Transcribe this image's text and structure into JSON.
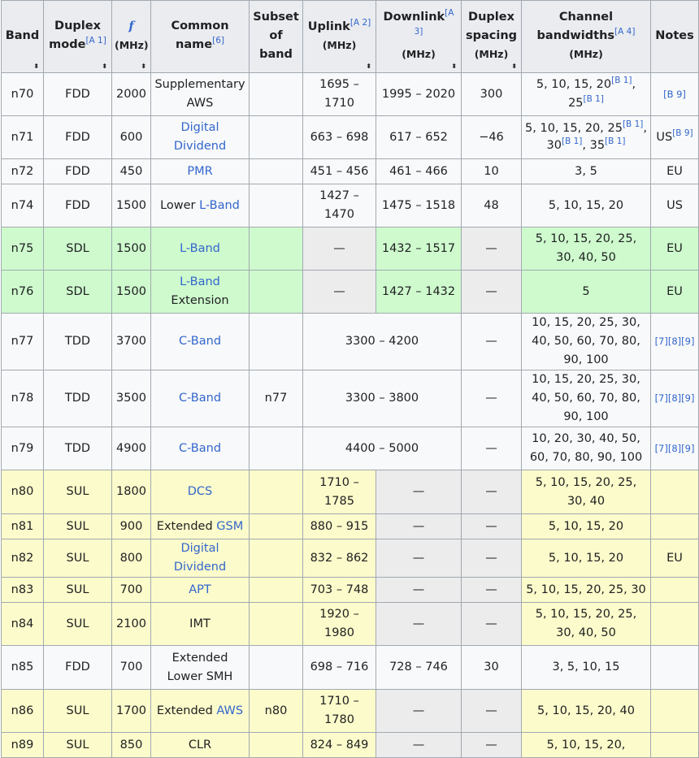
{
  "headers": {
    "band": "Band",
    "duplex_mode": "Duplex mode",
    "duplex_mode_ref": "[A 1]",
    "freq_symbol": "f",
    "freq_unit": "(MHz)",
    "common_name": "Common name",
    "common_name_ref": "[6]",
    "subset": "Subset of band",
    "uplink": "Uplink",
    "uplink_ref": "[A 2]",
    "uplink_unit": "(MHz)",
    "downlink": "Downlink",
    "downlink_ref": "[A 3]",
    "downlink_unit": "(MHz)",
    "duplex_spacing": "Duplex spacing",
    "duplex_spacing_unit": "(MHz)",
    "channel_bw": "Channel bandwidths",
    "channel_bw_ref": "[A 4]",
    "channel_bw_unit": "(MHz)",
    "notes": "Notes",
    "sort_glyph": "⬍"
  },
  "rows": {
    "n70": {
      "band": "n70",
      "mode": "FDD",
      "f": "2000",
      "name": "Supplementary AWS",
      "uplink": "1695 – 1710",
      "downlink": "1995 – 2020",
      "spacing": "300",
      "bw": "5, 10, 15, 20",
      "bw_ref": "[B 1]",
      "bw2": "25",
      "bw2_ref": "[B 1]",
      "notes_ref": "[B 9]"
    },
    "n71": {
      "band": "n71",
      "mode": "FDD",
      "f": "600",
      "name": "Digital Dividend",
      "uplink": "663 – 698",
      "downlink": "617 – 652",
      "spacing": "−46",
      "bw": "5, 10, 15, 20, 25",
      "bw_ref": "[B 1]",
      "bw2": "30",
      "bw2_ref": "[B 1]",
      "bw3": "35",
      "bw3_ref": "[B 1]",
      "notes": "US",
      "notes_ref": "[B 9]"
    },
    "n72": {
      "band": "n72",
      "mode": "FDD",
      "f": "450",
      "name": "PMR",
      "uplink": "451 – 456",
      "downlink": "461 – 466",
      "spacing": "10",
      "bw": "3, 5",
      "notes": "EU"
    },
    "n74": {
      "band": "n74",
      "mode": "FDD",
      "f": "1500",
      "name_prefix": "Lower",
      "name": "L-Band",
      "uplink": "1427 – 1470",
      "downlink": "1475 – 1518",
      "spacing": "48",
      "bw": "5, 10, 15, 20",
      "notes": "US"
    },
    "n75": {
      "band": "n75",
      "mode": "SDL",
      "f": "1500",
      "name": "L-Band",
      "uplink": "—",
      "downlink": "1432 – 1517",
      "spacing": "—",
      "bw": "5, 10, 15, 20, 25, 30, 40, 50",
      "notes": "EU"
    },
    "n76": {
      "band": "n76",
      "mode": "SDL",
      "f": "1500",
      "name": "L-Band",
      "name_suffix": "Extension",
      "uplink": "—",
      "downlink": "1427 – 1432",
      "spacing": "—",
      "bw": "5",
      "notes": "EU"
    },
    "n77": {
      "band": "n77",
      "mode": "TDD",
      "f": "3700",
      "name": "C-Band",
      "range": "3300 – 4200",
      "spacing": "—",
      "bw": "10, 15, 20, 25, 30, 40, 50, 60, 70, 80, 90, 100",
      "notes_ref": "[7][8][9]"
    },
    "n78": {
      "band": "n78",
      "mode": "TDD",
      "f": "3500",
      "name": "C-Band",
      "subset": "n77",
      "range": "3300 – 3800",
      "spacing": "—",
      "bw": "10, 15, 20, 25, 30, 40, 50, 60, 70, 80, 90, 100",
      "notes_ref": "[7][8][9]"
    },
    "n79": {
      "band": "n79",
      "mode": "TDD",
      "f": "4900",
      "name": "C-Band",
      "range": "4400 – 5000",
      "spacing": "—",
      "bw": "10, 20, 30, 40, 50, 60, 70, 80, 90, 100",
      "notes_ref": "[7][8][9]"
    },
    "n80": {
      "band": "n80",
      "mode": "SUL",
      "f": "1800",
      "name": "DCS",
      "uplink": "1710 – 1785",
      "downlink": "—",
      "spacing": "—",
      "bw": "5, 10, 15, 20, 25, 30, 40"
    },
    "n81": {
      "band": "n81",
      "mode": "SUL",
      "f": "900",
      "name_prefix": "Extended",
      "name": "GSM",
      "uplink": "880 – 915",
      "downlink": "—",
      "spacing": "—",
      "bw": "5, 10, 15, 20"
    },
    "n82": {
      "band": "n82",
      "mode": "SUL",
      "f": "800",
      "name": "Digital Dividend",
      "uplink": "832 – 862",
      "downlink": "—",
      "spacing": "—",
      "bw": "5, 10, 15, 20",
      "notes": "EU"
    },
    "n83": {
      "band": "n83",
      "mode": "SUL",
      "f": "700",
      "name": "APT",
      "uplink": "703 – 748",
      "downlink": "—",
      "spacing": "—",
      "bw": "5, 10, 15, 20, 25, 30"
    },
    "n84": {
      "band": "n84",
      "mode": "SUL",
      "f": "2100",
      "name": "IMT",
      "uplink": "1920 – 1980",
      "downlink": "—",
      "spacing": "—",
      "bw": "5, 10, 15, 20, 25, 30, 40, 50"
    },
    "n85": {
      "band": "n85",
      "mode": "FDD",
      "f": "700",
      "name": "Extended Lower SMH",
      "uplink": "698 – 716",
      "downlink": "728 – 746",
      "spacing": "30",
      "bw": "3, 5, 10, 15"
    },
    "n86": {
      "band": "n86",
      "mode": "SUL",
      "f": "1700",
      "name_prefix": "Extended",
      "name": "AWS",
      "subset": "n80",
      "uplink": "1710 – 1780",
      "downlink": "—",
      "spacing": "—",
      "bw": "5, 10, 15, 20, 40"
    },
    "n89": {
      "band": "n89",
      "mode": "SUL",
      "f": "850",
      "name": "CLR",
      "uplink": "824 – 849",
      "downlink": "—",
      "spacing": "—",
      "bw": "5, 10, 15, 20,"
    }
  }
}
